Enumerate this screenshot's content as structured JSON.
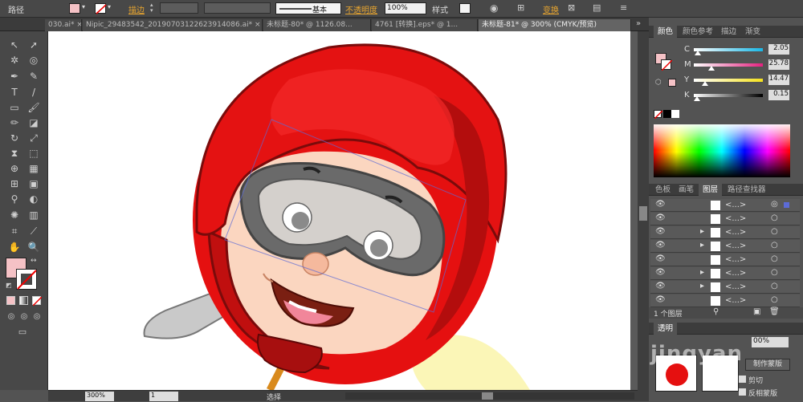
{
  "control_bar": {
    "object_type": "路径",
    "stroke_label": "描边",
    "stroke_style": "基本",
    "opacity_label": "不透明度",
    "opacity_value": "100%",
    "style_label": "样式",
    "transform_label": "变换"
  },
  "tabs": [
    {
      "label": "030.ai* ×"
    },
    {
      "label": "Nipic_29483542_20190703122623914086.ai* ×"
    },
    {
      "label": "未标题-80* @ 1126.08..."
    },
    {
      "label": "4761 [转换].eps* @ 1..."
    },
    {
      "label": "未标题-81* @ 300% (CMYK/预览)"
    }
  ],
  "panel_color": {
    "tabs": [
      "颜色",
      "颜色参考",
      "描边",
      "渐变"
    ],
    "channels": [
      {
        "name": "C",
        "value": "2.05",
        "pos": 2.05
      },
      {
        "name": "M",
        "value": "25.78",
        "pos": 25.78
      },
      {
        "name": "Y",
        "value": "14.47",
        "pos": 14.47
      },
      {
        "name": "K",
        "value": "0.15",
        "pos": 0.15
      }
    ]
  },
  "panel_layers": {
    "tabs": [
      "色板",
      "画笔",
      "图层",
      "路径查找器"
    ],
    "rows": [
      {
        "name": "<...>"
      },
      {
        "name": "<...>"
      },
      {
        "name": "<...>"
      },
      {
        "name": "<...>"
      },
      {
        "name": "<...>"
      },
      {
        "name": "<...>"
      },
      {
        "name": "<...>"
      },
      {
        "name": "<...>"
      }
    ],
    "footer": "1 个图层"
  },
  "panel_transparency": {
    "tab": "透明",
    "opacity": "00%",
    "make_mask": "制作蒙版",
    "clip": "剪切",
    "invert_mask": "反相蒙版"
  },
  "status": {
    "zoom": "300%",
    "page": "1",
    "tool": "选择"
  },
  "watermark": "jingyan"
}
